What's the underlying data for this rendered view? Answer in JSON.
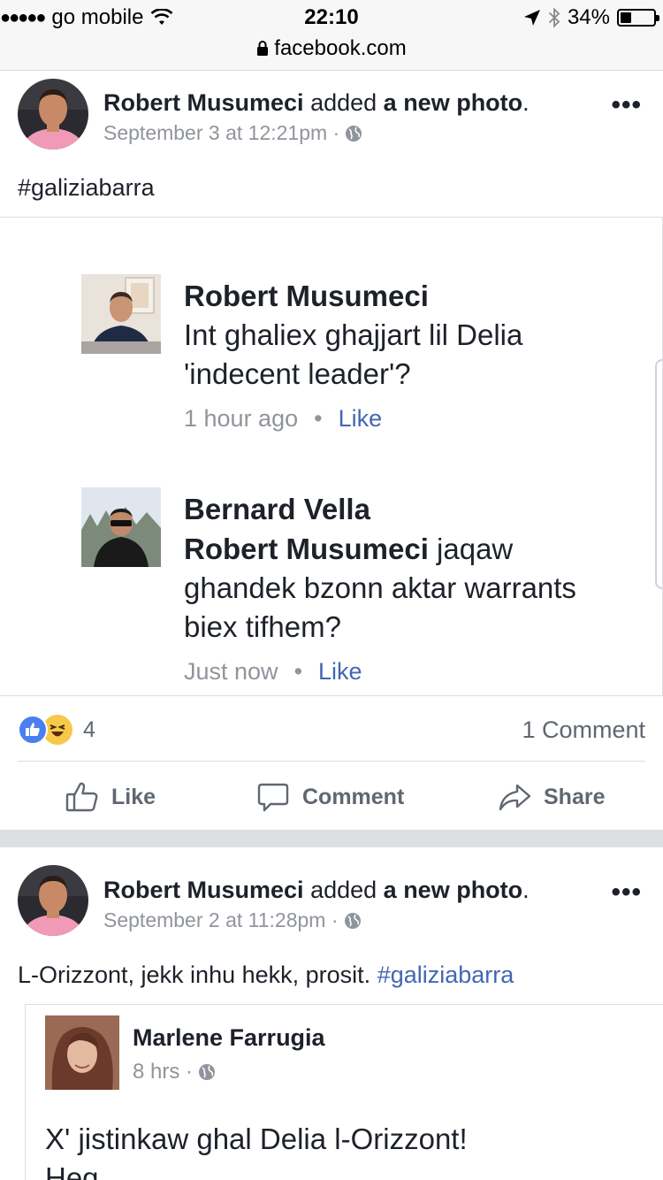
{
  "status_bar": {
    "signal": "●●●●●",
    "carrier": "go mobile",
    "time": "22:10",
    "url": "facebook.com",
    "battery": "34%",
    "battery_level": 0.34
  },
  "post1": {
    "author": "Robert Musumeci",
    "action_prefix": "added",
    "action_bold": "a new photo",
    "action_suffix": ".",
    "timestamp": "September 3 at 12:21pm ·",
    "more": "•••",
    "text": "#galiziabarra",
    "photo": {
      "comments": [
        {
          "name": "Robert Musumeci",
          "line1": "Int ghaliex ghajjart lil Delia",
          "line2": "'indecent leader'?",
          "time": "1 hour ago",
          "dot": "•",
          "like": "Like"
        },
        {
          "name": "Bernard Vella",
          "mention": "Robert Musumeci",
          "line1_rest": " jaqaw",
          "line2": "ghandek bzonn aktar warrants",
          "line3": "biex tifhem?",
          "time": "Just now",
          "dot": "•",
          "like": "Like"
        }
      ]
    },
    "reaction_count": "4",
    "comment_count": "1 Comment",
    "actions": {
      "like": "Like",
      "comment": "Comment",
      "share": "Share"
    }
  },
  "post2": {
    "author": "Robert Musumeci",
    "action_prefix": "added",
    "action_bold": "a new photo",
    "action_suffix": ".",
    "timestamp": "September 2 at 11:28pm ·",
    "more": "•••",
    "text_plain": "L-Orizzont, jekk inhu hekk, prosit.",
    "text_hashtag": "#galiziabarra",
    "shared": {
      "name": "Marlene Farrugia",
      "time": "8 hrs ·",
      "line1": "X' jistinkaw ghal Delia l-Orizzont!",
      "line2": "Heq"
    }
  },
  "colors": {
    "link": "#4267b2",
    "meta": "#90949c",
    "like_reaction": "#4a7ff0",
    "haha_reaction": "#f7c84a"
  }
}
